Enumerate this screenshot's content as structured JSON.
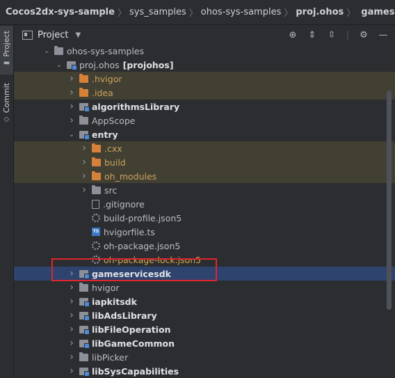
{
  "breadcrumb": [
    "Cocos2dx-sys-sample",
    "sys_samples",
    "ohos-sys-samples",
    "proj.ohos",
    "gameservicesdk"
  ],
  "left_tabs": {
    "project": "Project",
    "commit": "Commit"
  },
  "panel": {
    "title": "Project"
  },
  "toolbar": {
    "locate": "locate-icon",
    "expand": "expand-all-icon",
    "collapse": "collapse-all-icon",
    "settings": "gear-icon",
    "hide": "minimize-icon"
  },
  "tree": [
    {
      "label": "ohos-sys-samples",
      "suffix": "",
      "icon": "folder",
      "arrow": "open",
      "style": "normal"
    },
    {
      "label": "proj.ohos",
      "suffix": "[projohos]",
      "icon": "module",
      "arrow": "open",
      "style": "normal"
    },
    {
      "label": ".hvigor",
      "suffix": "",
      "icon": "folder-orange",
      "arrow": "closed",
      "style": "excluded"
    },
    {
      "label": ".idea",
      "suffix": "",
      "icon": "folder-orange",
      "arrow": "closed",
      "style": "excluded"
    },
    {
      "label": "algorithmsLibrary",
      "suffix": "",
      "icon": "module",
      "arrow": "closed",
      "style": "bold"
    },
    {
      "label": "AppScope",
      "suffix": "",
      "icon": "folder",
      "arrow": "closed",
      "style": "normal"
    },
    {
      "label": "entry",
      "suffix": "",
      "icon": "module",
      "arrow": "open",
      "style": "bold"
    },
    {
      "label": ".cxx",
      "suffix": "",
      "icon": "folder-orange",
      "arrow": "closed",
      "style": "excluded"
    },
    {
      "label": "build",
      "suffix": "",
      "icon": "folder-orange",
      "arrow": "closed",
      "style": "excluded"
    },
    {
      "label": "oh_modules",
      "suffix": "",
      "icon": "folder-orange",
      "arrow": "closed",
      "style": "excluded"
    },
    {
      "label": "src",
      "suffix": "",
      "icon": "folder",
      "arrow": "closed",
      "style": "normal"
    },
    {
      "label": ".gitignore",
      "suffix": "",
      "icon": "file",
      "arrow": "none",
      "style": "normal"
    },
    {
      "label": "build-profile.json5",
      "suffix": "",
      "icon": "gear",
      "arrow": "none",
      "style": "normal"
    },
    {
      "label": "hvigorfile.ts",
      "suffix": "",
      "icon": "ts",
      "arrow": "none",
      "style": "normal"
    },
    {
      "label": "oh-package.json5",
      "suffix": "",
      "icon": "gear",
      "arrow": "none",
      "style": "normal"
    },
    {
      "label": "oh-package-lock.json5",
      "suffix": "",
      "icon": "gear",
      "arrow": "none",
      "style": "yellow"
    },
    {
      "label": "gameservicesdk",
      "suffix": "",
      "icon": "module",
      "arrow": "closed",
      "style": "bold"
    },
    {
      "label": "hvigor",
      "suffix": "",
      "icon": "folder",
      "arrow": "closed",
      "style": "normal"
    },
    {
      "label": "iapkitsdk",
      "suffix": "",
      "icon": "module",
      "arrow": "closed",
      "style": "bold"
    },
    {
      "label": "libAdsLibrary",
      "suffix": "",
      "icon": "module",
      "arrow": "closed",
      "style": "bold"
    },
    {
      "label": "libFileOperation",
      "suffix": "",
      "icon": "module",
      "arrow": "closed",
      "style": "bold"
    },
    {
      "label": "libGameCommon",
      "suffix": "",
      "icon": "module",
      "arrow": "closed",
      "style": "bold"
    },
    {
      "label": "libPicker",
      "suffix": "",
      "icon": "folder",
      "arrow": "closed",
      "style": "normal"
    },
    {
      "label": "libSysCapabilities",
      "suffix": "",
      "icon": "module",
      "arrow": "closed",
      "style": "bold"
    }
  ]
}
